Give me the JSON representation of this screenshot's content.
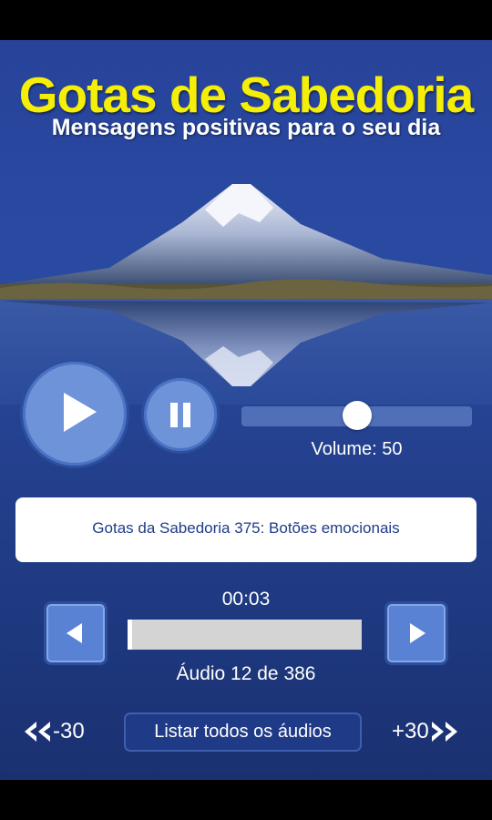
{
  "app": {
    "title": "Gotas de Sabedoria",
    "subtitle": "Mensagens positivas para o seu dia"
  },
  "controls": {
    "play_icon": "play-icon",
    "pause_icon": "pause-icon",
    "volume_value": 50,
    "volume_label": "Volume: 50"
  },
  "track": {
    "title": "Gotas da Sabedoria 375: Botões emocionais",
    "elapsed": "00:03",
    "progress": 0.02,
    "counter": "Áudio 12 de 386"
  },
  "nav": {
    "prev_icon": "triangle-left-icon",
    "next_icon": "triangle-right-icon"
  },
  "footer": {
    "back_label": "-30",
    "forward_label": "+30",
    "list_label": "Listar todos os áudios"
  },
  "colors": {
    "background": "#27439a",
    "title": "#f5ef08",
    "button": "#6e93d8"
  }
}
